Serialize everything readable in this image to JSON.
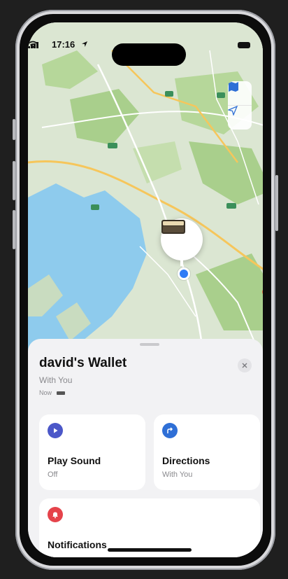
{
  "status_bar": {
    "time": "17:16"
  },
  "item": {
    "name": "david's Wallet",
    "status": "With You",
    "last_seen": "Now"
  },
  "actions": [
    {
      "label": "Play Sound",
      "value": "Off",
      "icon": "play-icon",
      "color": "#4b57c8"
    },
    {
      "label": "Directions",
      "value": "With You",
      "icon": "directions-icon",
      "color": "#2f6fd6"
    },
    {
      "label": "Notifications",
      "value": "",
      "icon": "bell-icon",
      "color": "#e5434b"
    }
  ],
  "colors": {
    "water": "#8ecbed",
    "land": "#dbe6d2",
    "park": "#a9cf8c"
  }
}
